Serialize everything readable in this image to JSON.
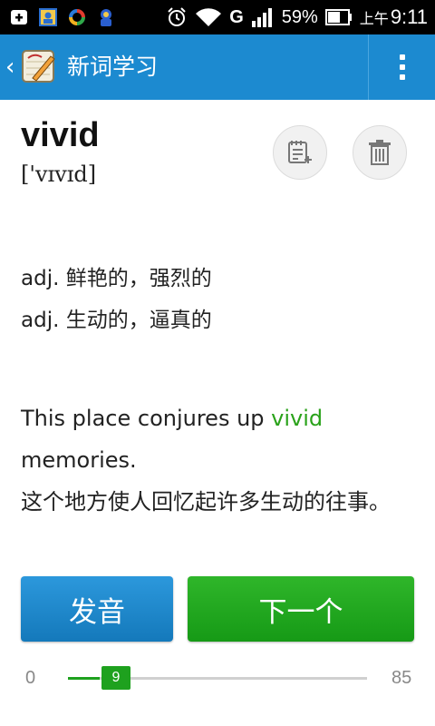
{
  "status_bar": {
    "battery_percent": "59%",
    "time_prefix": "上午",
    "time": "9:11",
    "network_label": "G",
    "left_icons": [
      "add-box-icon",
      "contact-card-icon",
      "sync-app-icon",
      "baby-app-icon"
    ],
    "right_icons": [
      "alarm-icon",
      "wifi-icon",
      "signal-icon",
      "battery-icon"
    ]
  },
  "action_bar": {
    "title": "新词学习",
    "color": "#1c8ad0"
  },
  "word": {
    "text": "vivid",
    "phonetic": "['vɪvɪd]"
  },
  "meanings": [
    "adj. 鲜艳的，强烈的",
    "adj. 生动的，逼真的"
  ],
  "example": {
    "before": "This place conjures up ",
    "highlight": "vivid",
    "after": " memories.",
    "translation": "这个地方使人回忆起许多生动的往事。",
    "highlight_color": "#2aa21a"
  },
  "buttons": {
    "pronounce": "发音",
    "next": "下一个"
  },
  "progress": {
    "min": "0",
    "max": "85",
    "current": "9",
    "current_value": 9,
    "max_value": 85
  }
}
